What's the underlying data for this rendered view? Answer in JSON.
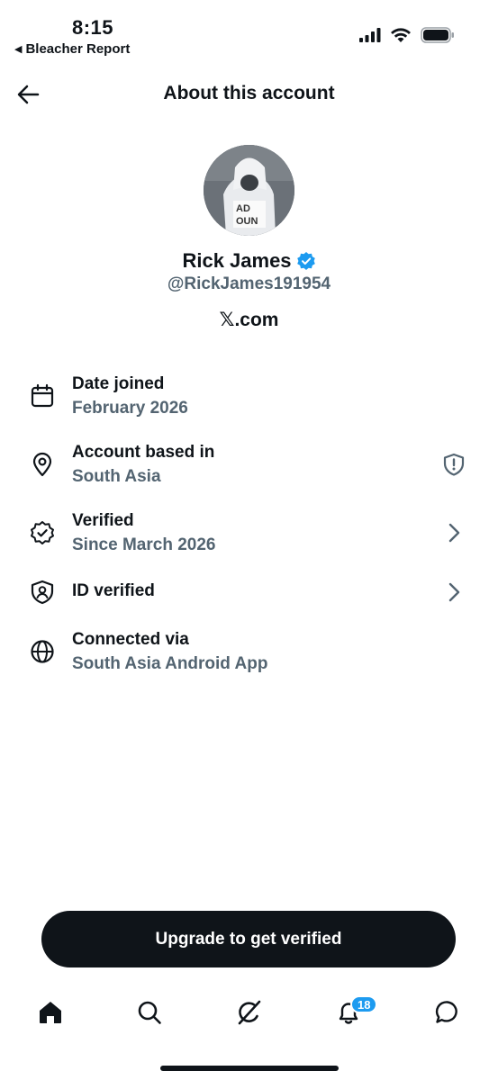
{
  "status_bar": {
    "time": "8:15",
    "back_app_label": "Bleacher Report",
    "icons": [
      "signal-icon",
      "wifi-icon",
      "battery-icon"
    ]
  },
  "header": {
    "title": "About this account",
    "back_icon": "arrow-left-icon"
  },
  "profile": {
    "name": "Rick James",
    "handle": "@RickJames191954",
    "site": "𝕏.com",
    "verified_badge_color": "#1d9bf0"
  },
  "info_rows": [
    {
      "title": "Date joined",
      "subtitle": "February 2026",
      "icon": "calendar-icon"
    },
    {
      "title": "Account based in",
      "subtitle": "South Asia",
      "icon": "location-pin-icon",
      "right_icon": "shield-alert-icon"
    },
    {
      "title": "Verified",
      "subtitle": "Since March 2026",
      "icon": "verified-badge-icon",
      "right_icon": "chevron-right-icon"
    },
    {
      "title": "ID verified",
      "subtitle": "",
      "icon": "id-shield-icon",
      "right_icon": "chevron-right-icon"
    },
    {
      "title": "Connected via",
      "subtitle": "South Asia Android App",
      "icon": "globe-icon"
    }
  ],
  "upgrade_button": {
    "label": "Upgrade to get verified"
  },
  "bottom_nav": {
    "items": [
      "home-icon",
      "search-icon",
      "grok-icon",
      "notifications-icon",
      "messages-icon"
    ],
    "notifications_badge": "18",
    "badge_color": "#1d9bf0"
  },
  "colors": {
    "text_primary": "#0f1419",
    "text_secondary": "#536471",
    "accent": "#1d9bf0"
  }
}
